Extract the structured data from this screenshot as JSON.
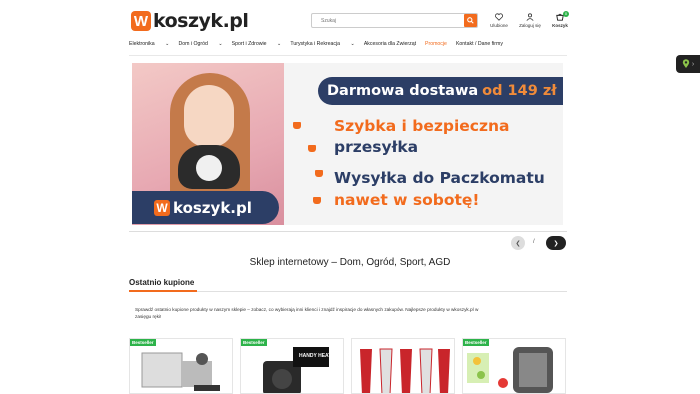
{
  "header": {
    "logo_badge": "W",
    "logo_text": "koszyk.pl",
    "search_placeholder": "Szukaj",
    "favorites_label": "Ulubione",
    "login_label": "Zaloguj się",
    "cart_label": "Koszyk",
    "cart_count": "0"
  },
  "nav": {
    "items": [
      "Elektronika",
      "Dom i Ogród",
      "Sport i Zdrowie",
      "Turystyka i Rekreacja",
      "Akcesoria dla Zwierząt",
      "Promocje",
      "Kontakt / Dane firmy"
    ]
  },
  "banner": {
    "top_text": "Darmowa dostawa",
    "top_highlight": "od 149 zł",
    "line1": "Szybka i bezpieczna",
    "line2": "przesyłka",
    "line3": "Wysyłka do Paczkomatu",
    "line4": "nawet w sobotę!",
    "logo_badge": "W",
    "logo_text": "koszyk.pl"
  },
  "slider": {
    "separator": "/"
  },
  "tagline": "Sklep internetowy – Dom, Ogród, Sport, AGD",
  "recent": {
    "title": "Ostatnio kupione",
    "description": "Sprawdź ostatnio kupione produkty w naszym sklepie – zobacz, co wybierają inni klienci i znajdź inspiracje do własnych zakupów. Najlepsze produkty w wkoszyk.pl w zasięgu ręki!",
    "badge": "Bestseller",
    "product2_label": "HANDY HEATER"
  },
  "colors": {
    "brand": "#f26b1d",
    "navy": "#2c3e66",
    "badge": "#2db34a"
  }
}
